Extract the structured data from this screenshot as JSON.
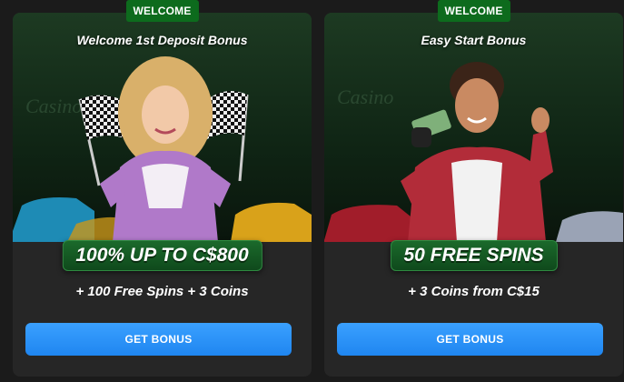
{
  "cards": [
    {
      "badge": "WELCOME",
      "title": "Welcome 1st Deposit Bonus",
      "offer": "100% UP TO C$800",
      "subtitle": "+ 100 Free Spins + 3 Coins",
      "button": "GET BONUS",
      "illustration": "woman-with-racing-flags"
    },
    {
      "badge": "WELCOME",
      "title": "Easy Start Bonus",
      "offer": "50 FREE SPINS",
      "subtitle": "+ 3 Coins from C$15",
      "button": "GET BONUS",
      "illustration": "man-with-cash"
    }
  ],
  "colors": {
    "page_bg": "#1b1b1b",
    "card_bg": "#262626",
    "badge_bg": "#0d6b1d",
    "offer_bg": "#0f4a1c",
    "button_bg": "#2b93ff"
  }
}
